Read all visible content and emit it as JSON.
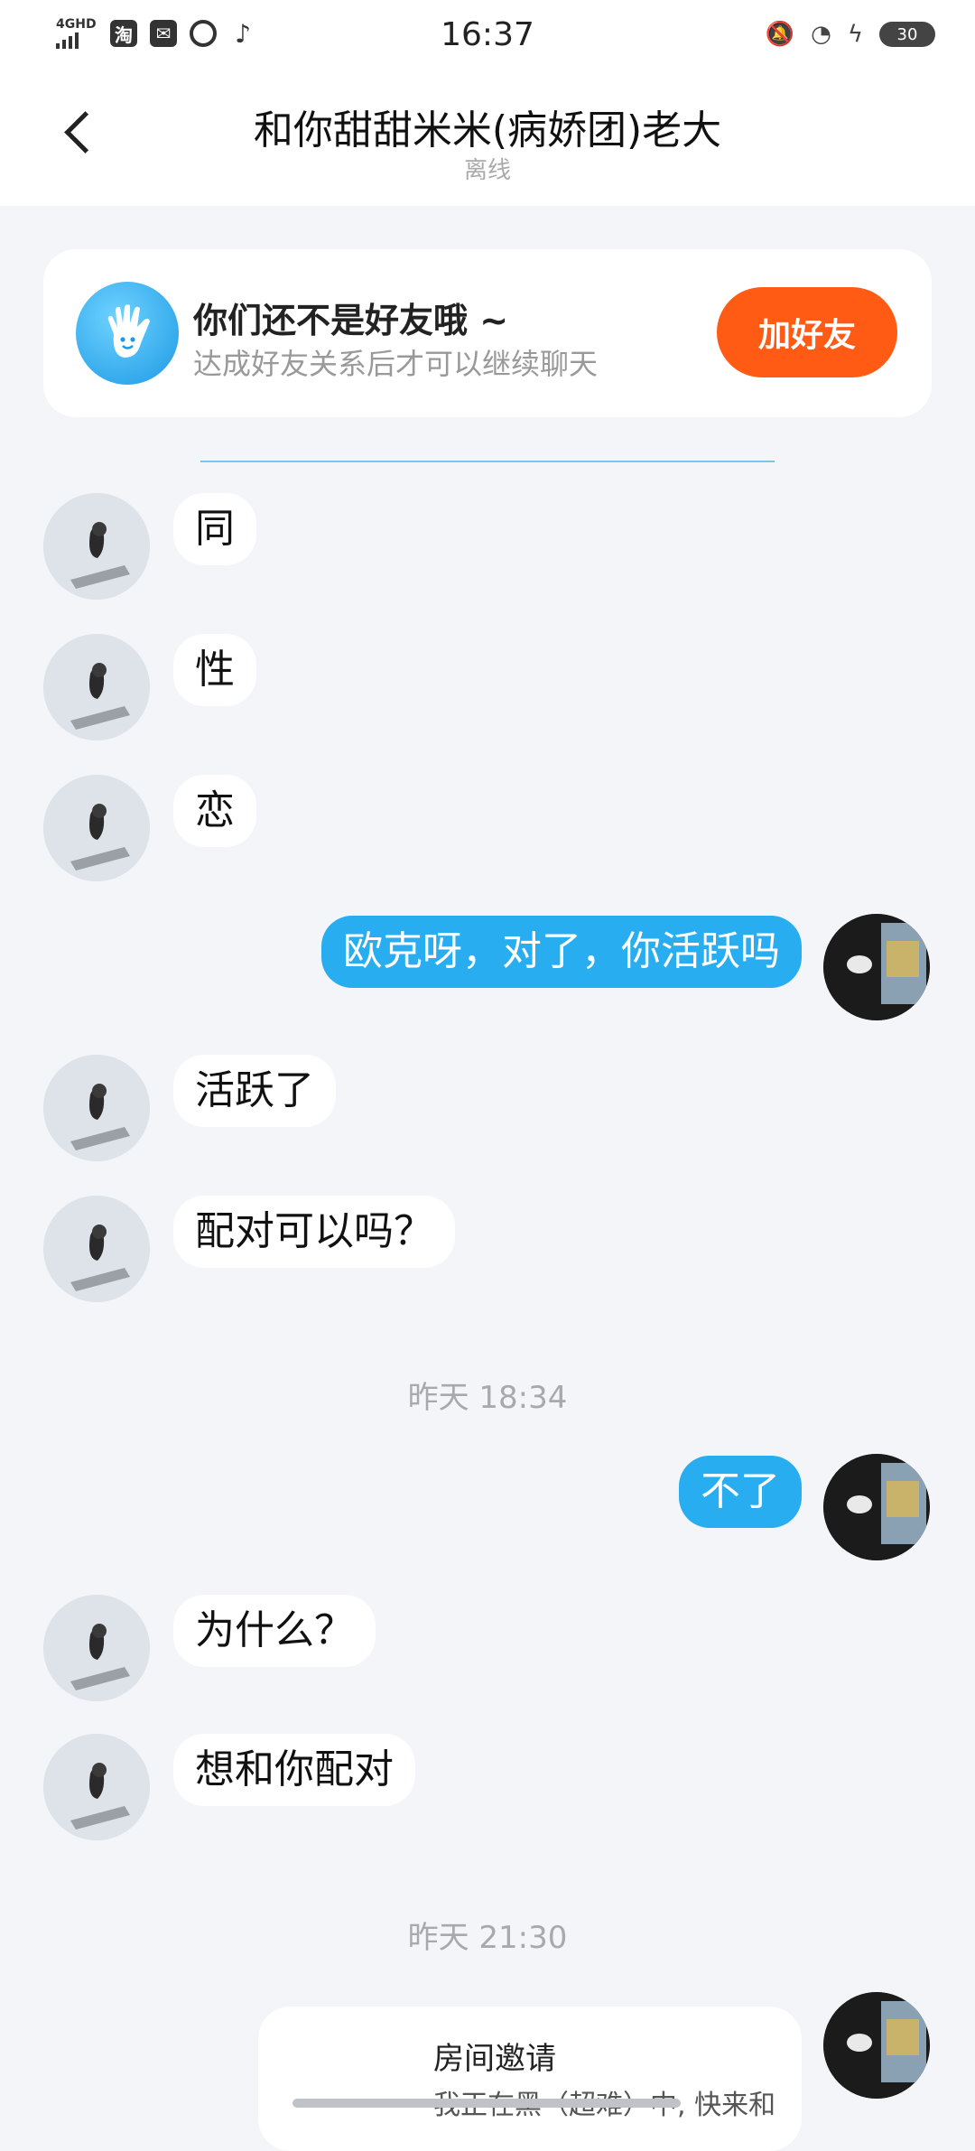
{
  "status_bar": {
    "network": "4GHD",
    "app_icons": [
      "taobao-icon",
      "mail-icon",
      "qq-icon",
      "tiktok-icon"
    ],
    "time": "16:37",
    "battery": "30",
    "right_icons": [
      "mute-bell-icon",
      "wifi-icon",
      "charging-icon",
      "battery-icon"
    ]
  },
  "header": {
    "title": "和你甜甜米米(病娇团)老大",
    "subtitle": "离线",
    "back_icon": "chevron-left-icon"
  },
  "banner": {
    "title": "你们还不是好友哦 ~",
    "description": "达成好友关系后才可以继续聊天",
    "button": "加好友",
    "icon": "waving-hand-icon"
  },
  "colors": {
    "accent": "#28aef0",
    "add_button": "#ff5b14",
    "background": "#f3f5f8"
  },
  "messages": [
    {
      "from": "peer",
      "text": "同"
    },
    {
      "from": "peer",
      "text": "性"
    },
    {
      "from": "peer",
      "text": "恋"
    },
    {
      "from": "me",
      "text": "欧克呀，对了，你活跃吗"
    },
    {
      "from": "peer",
      "text": "活跃了"
    },
    {
      "from": "peer",
      "text": "配对可以吗？"
    },
    {
      "from": "time",
      "text": "昨天 18:34"
    },
    {
      "from": "me",
      "text": "不了"
    },
    {
      "from": "peer",
      "text": "为什么？"
    },
    {
      "from": "peer",
      "text": "想和你配对"
    },
    {
      "from": "time",
      "text": "昨天 21:30"
    }
  ],
  "invite": {
    "title": "房间邀请",
    "text": "我正在黑（超难）中, 快来和"
  }
}
